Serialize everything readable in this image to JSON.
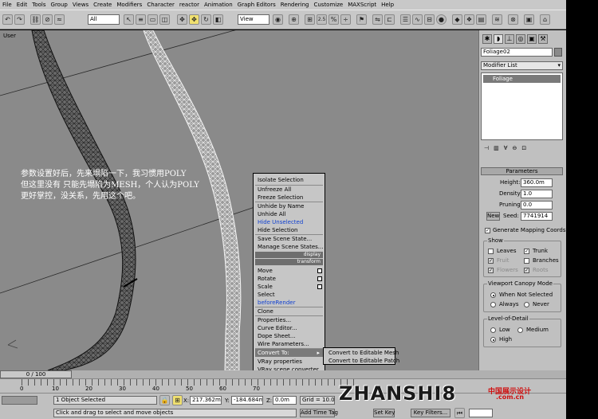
{
  "menu": [
    "File",
    "Edit",
    "Tools",
    "Group",
    "Views",
    "Create",
    "Modifiers",
    "Character",
    "reactor",
    "Animation",
    "Graph Editors",
    "Rendering",
    "Customize",
    "MAXScript",
    "Help"
  ],
  "toolbar": {
    "selection_filter": "All",
    "ref_coord": "View",
    "snap_value": "2.5"
  },
  "viewport": {
    "label": "User"
  },
  "panel": {
    "object_name": "Foliage02",
    "modifier_list": "Modifier List",
    "stack_item": "Foliage",
    "rollout": "Parameters",
    "height_label": "Height:",
    "height_value": "360.0m",
    "density_label": "Density:",
    "density_value": "1.0",
    "pruning_label": "Pruning:",
    "pruning_value": "0.0",
    "new_label": "New",
    "seed_label": "Seed:",
    "seed_value": "7741914",
    "gen_mapping": "Generate Mapping Coords.",
    "show_group": "Show",
    "show_items": [
      {
        "label": "Leaves",
        "checked": false,
        "dim": false
      },
      {
        "label": "Trunk",
        "checked": true,
        "dim": false
      },
      {
        "label": "Fruit",
        "checked": true,
        "dim": true
      },
      {
        "label": "Branches",
        "checked": false,
        "dim": false
      },
      {
        "label": "Flowers",
        "checked": true,
        "dim": true
      },
      {
        "label": "Roots",
        "checked": true,
        "dim": true
      }
    ],
    "canopy_group": "Viewport Canopy Mode",
    "canopy_items": [
      "When Not Selected",
      "Always",
      "Never"
    ],
    "lod_group": "Level-of-Detail",
    "lod_items": [
      "Low",
      "Medium",
      "High"
    ]
  },
  "annotation": [
    "参数设置好后，先来塌陷一下，我习惯用POLY",
    "但这里没有 只能先塌陷为MESH，个人认为POLY",
    "更好掌控，没关系，先用这个吧。"
  ],
  "quad_menu": {
    "display_items": [
      "Isolate Selection",
      "Unfreeze All",
      "Freeze Selection",
      "Unhide by Name",
      "Unhide All",
      "Hide Unselected",
      "Hide Selection",
      "Save Scene State...",
      "Manage Scene States..."
    ],
    "display_header": "display",
    "transform_header": "transform",
    "transform_items": [
      "Move",
      "Rotate",
      "Scale",
      "Select",
      "beforeRender",
      "Clone",
      "Properties...",
      "Curve Editor...",
      "Dope Sheet...",
      "Wire Parameters...",
      "Convert To:",
      "VRay properties",
      "VRay scene converter"
    ],
    "submenu": [
      "Convert to Editable Mesh",
      "Convert to Editable Patch"
    ]
  },
  "time": {
    "slider": "0 / 100",
    "ticks": [
      "0",
      "10",
      "20",
      "30",
      "40",
      "50",
      "60",
      "70"
    ]
  },
  "status": {
    "selection": "1 Object Selected",
    "prompt": "Click and drag to select and move objects",
    "x": "217.362m",
    "y": "-184.684m",
    "z": "0.0m",
    "grid": "Grid = 10.0m",
    "add_time_tag": "Add Time Tag",
    "set_key": "Set Key",
    "key_filters": "Key Filters..."
  },
  "watermark": {
    "text": "ZHANSHI8",
    "suffix": ".com.cn",
    "tagline": "中国展示设计"
  }
}
